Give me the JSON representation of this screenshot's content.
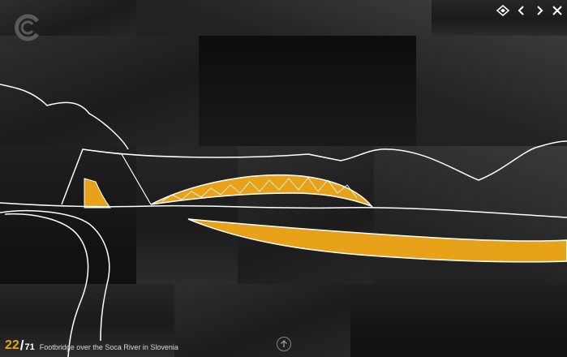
{
  "slide": {
    "current": "22",
    "separator": "/",
    "total": "71",
    "title": "Footbridge over the Soca River in Slovenia"
  },
  "controls": {
    "fullscreen": "fullscreen-icon",
    "prev": "chevron-left-icon",
    "next": "chevron-right-icon",
    "close": "close-icon",
    "scroll_up": "arrow-up-icon"
  },
  "colors": {
    "accent": "#e8a21a",
    "line": "#ffffff",
    "background": "#141414"
  }
}
